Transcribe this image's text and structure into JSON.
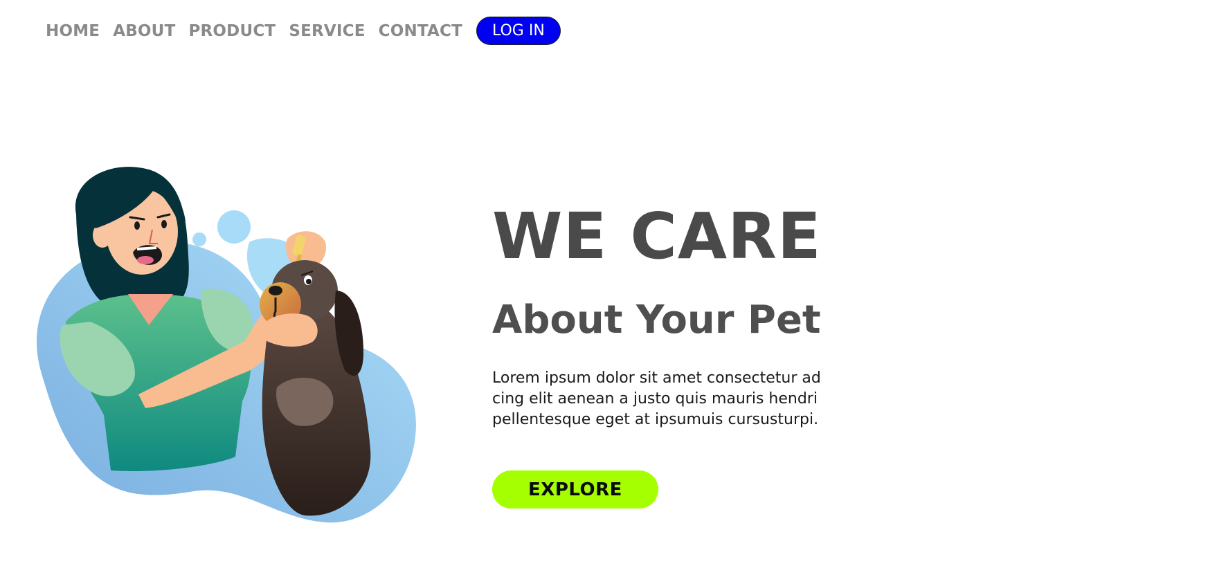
{
  "nav": {
    "items": [
      {
        "label": "HOME"
      },
      {
        "label": "ABOUT"
      },
      {
        "label": "PRODUCT"
      },
      {
        "label": "SERVICE"
      },
      {
        "label": "CONTACT"
      }
    ],
    "login_label": "LOG IN"
  },
  "hero": {
    "title": "WE CARE",
    "subtitle": "About Your Pet",
    "body_lines": [
      "Lorem ipsum dolor sit amet consectetur ad",
      "cing elit aenean a justo quis mauris hendri",
      "pellentesque eget at ipsumuis cursusturpi."
    ],
    "cta_label": "EXPLORE"
  },
  "colors": {
    "nav_text": "#8a8a8a",
    "login_bg": "#0000f2",
    "login_text": "#ffffff",
    "title_text": "#4a4a4a",
    "cta_bg": "#a6ff00",
    "blob_blue": "#8ec5ee",
    "shirt_green": "#2fae8a",
    "hair": "#05323a",
    "skin": "#f7b990",
    "dog_brown": "#4a3a33"
  },
  "icons": {
    "illustration": "woman-giving-eye-drops-to-dog-illustration"
  }
}
